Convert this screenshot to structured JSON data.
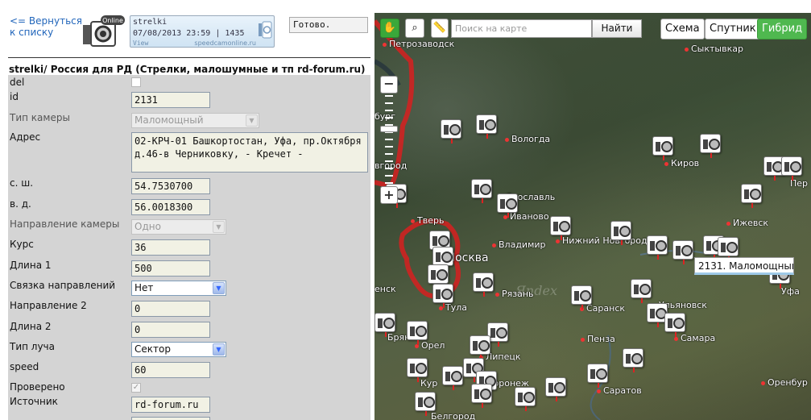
{
  "header": {
    "back_link": "<= Вернуться к списку",
    "logo_text": "Online",
    "banner": {
      "line1": "strelki",
      "line2": "07/08/2013 23:59 | 1435",
      "line3": "View",
      "site": "speedcamonline.ru"
    },
    "status": "Готово."
  },
  "form": {
    "title": "strelki/ Россия для РД (Стрелки, малошумные и тп rd-forum.ru)",
    "labels": {
      "del": "del",
      "id": "id",
      "camera_type": "Тип камеры",
      "address": "Адрес",
      "lat": "с. ш.",
      "lon": "в. д.",
      "camera_direction": "Направление камеры",
      "course": "Курс",
      "length1": "Длина 1",
      "link_directions": "Связка направлений",
      "direction2": "Направление 2",
      "length2": "Длина 2",
      "beam_type": "Тип луча",
      "speed": "speed",
      "verified": "Проверено",
      "source": "Источник"
    },
    "values": {
      "id": "2131",
      "camera_type": "Маломощный",
      "address": "02-КРЧ-01 Башкортостан, Уфа, пр.Октября д.46-в Черниковку, - Кречет -",
      "lat": "54.7530700",
      "lon": "56.0018300",
      "camera_direction": "Одно",
      "course": "36",
      "length1": "500",
      "link_directions": "Нет",
      "direction2": "0",
      "length2": "0",
      "beam_type": "Сектор",
      "speed": "60",
      "verified_mark": "✓",
      "source": "rd-forum.ru"
    }
  },
  "map": {
    "search_placeholder": "Поиск на карте",
    "find_button": "Найти",
    "layers": {
      "scheme": "Схема",
      "satellite": "Спутник",
      "hybrid": "Гибрид"
    },
    "zoom_minus": "−",
    "zoom_plus": "+",
    "tooltip": "2131. Маломощный",
    "watermark": "Яndex",
    "cities": {
      "petrozavodsk": "Петрозаводск",
      "syktyvkar": "Сыктывкар",
      "vologda": "Вологда",
      "kirov": "Киров",
      "perm": "Пер",
      "yaroslavl": "Ярославль",
      "ivanovo": "Иваново",
      "tver": "Тверь",
      "izhevsk": "Ижевск",
      "vladimir": "Владимир",
      "nizhny": "Нижний Новгород",
      "moscow": "Москва",
      "ryazan": "Рязань",
      "ufa": "Уфа",
      "saransk": "Саранск",
      "tula": "Тула",
      "ulyanovsk": "Ульяновск",
      "samara": "Самара",
      "oryol": "Орел",
      "bryansk": "Брян",
      "penza": "Пенза",
      "lipetsk": "Липецк",
      "kursk": "Кур",
      "voronezh": "Воронеж",
      "saratov": "Саратов",
      "orenburg": "Оренбур",
      "belgorod": "Белгород",
      "burg": "бург",
      "novgorod": "вгород",
      "smolensk": "енск"
    }
  }
}
